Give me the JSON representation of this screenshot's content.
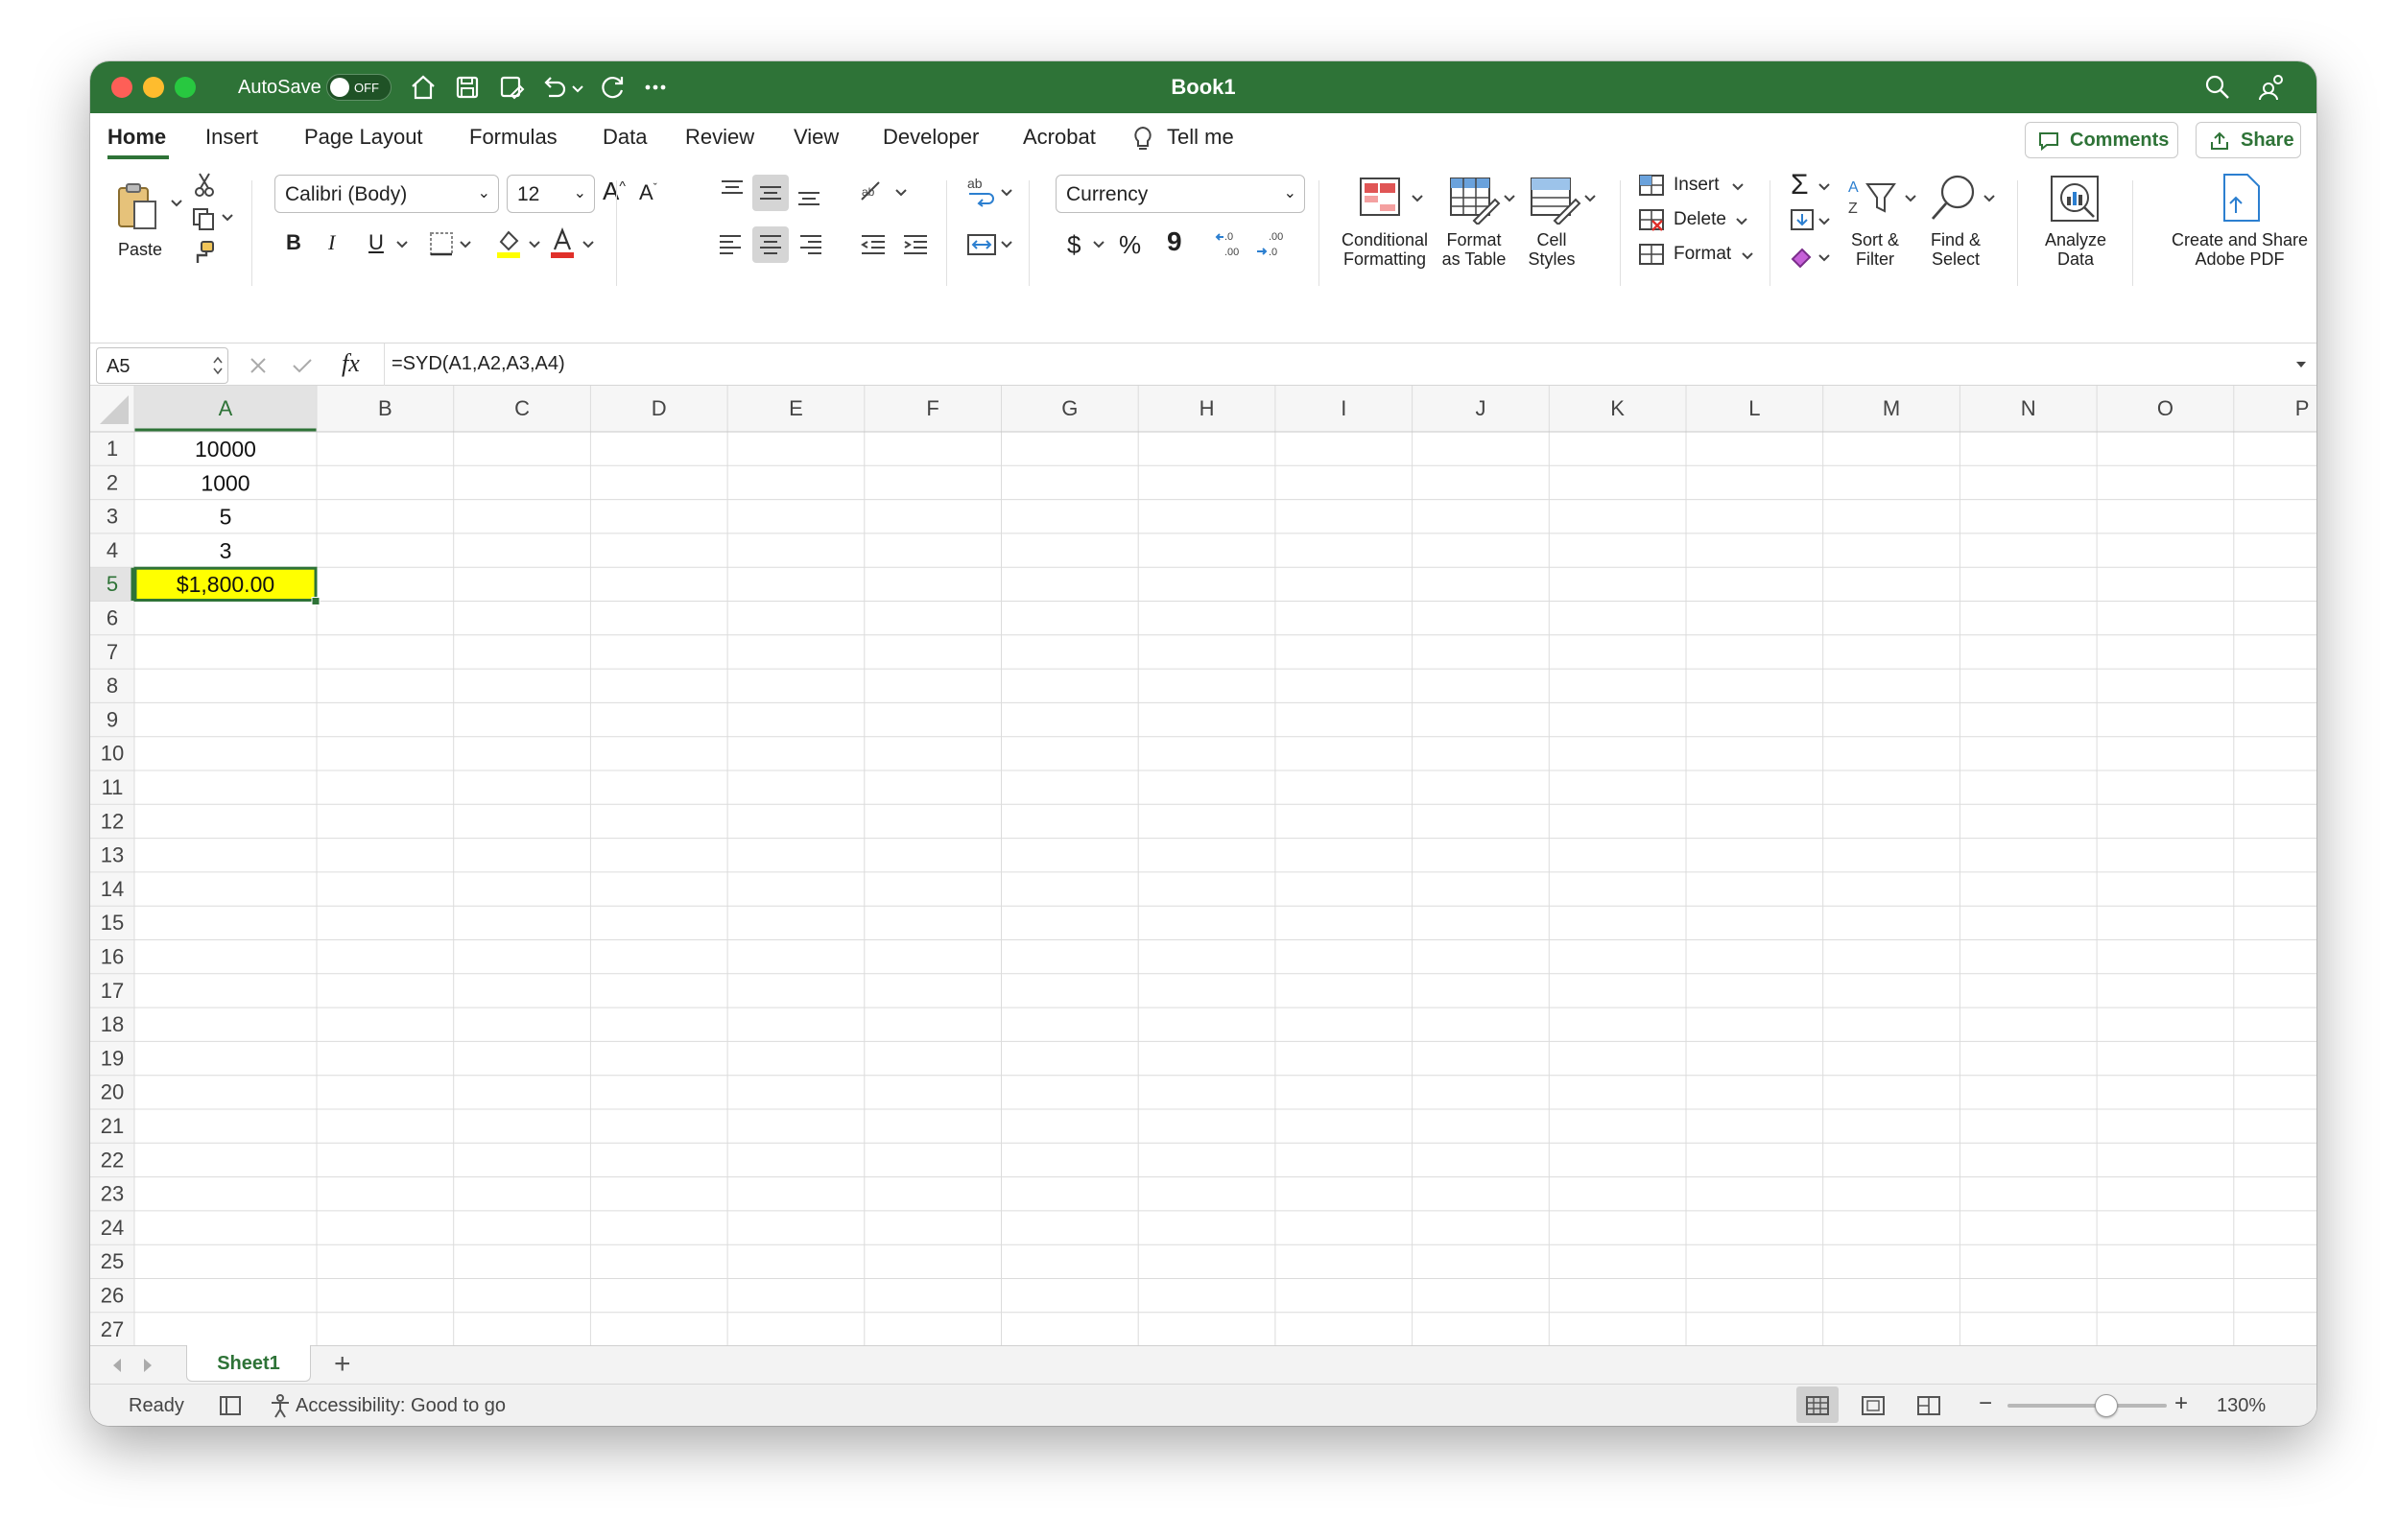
{
  "window": {
    "title": "Book1"
  },
  "titlebar": {
    "autosave_label": "AutoSave",
    "autosave_state": "OFF",
    "icons": [
      "home-icon",
      "save-icon",
      "save-as-icon",
      "undo-icon",
      "redo-icon",
      "more-icon",
      "search-icon",
      "share-people-icon"
    ]
  },
  "tabs": [
    "Home",
    "Insert",
    "Page Layout",
    "Formulas",
    "Data",
    "Review",
    "View",
    "Developer",
    "Acrobat"
  ],
  "tell_me": "Tell me",
  "buttons": {
    "comments": "Comments",
    "share": "Share"
  },
  "ribbon": {
    "paste": "Paste",
    "font_name": "Calibri (Body)",
    "font_size": "12",
    "bold": "B",
    "italic": "I",
    "underline": "U",
    "number_format": "Currency",
    "currency_symbol": "$",
    "percent_symbol": "%",
    "comma_symbol": "9",
    "conditional_formatting": [
      "Conditional",
      "Formatting"
    ],
    "format_as_table": [
      "Format",
      "as Table"
    ],
    "cell_styles": [
      "Cell",
      "Styles"
    ],
    "insert": "Insert",
    "delete": "Delete",
    "format": "Format",
    "sort_filter": [
      "Sort &",
      "Filter"
    ],
    "find_select": [
      "Find &",
      "Select"
    ],
    "analyze_data": [
      "Analyze",
      "Data"
    ],
    "adobe_pdf": [
      "Create and Share",
      "Adobe PDF"
    ]
  },
  "formula_bar": {
    "name_box": "A5",
    "fx": "fx",
    "formula": "=SYD(A1,A2,A3,A4)"
  },
  "sheet": {
    "columns": [
      "A",
      "B",
      "C",
      "D",
      "E",
      "F",
      "G",
      "H",
      "I",
      "J",
      "K",
      "L",
      "M",
      "N",
      "O",
      "P"
    ],
    "row_count": 29,
    "active_cell": "A5",
    "cells": {
      "A1": "10000",
      "A2": "1000",
      "A3": "5",
      "A4": "3",
      "A5": "$1,800.00"
    },
    "highlight_color": "#ffff00",
    "accent_color": "#2e7337"
  },
  "sheet_tabs": {
    "active": "Sheet1",
    "add": "+"
  },
  "status": {
    "ready": "Ready",
    "accessibility": "Accessibility: Good to go",
    "zoom": "130%",
    "zoom_minus": "−",
    "zoom_plus": "+",
    "zoom_level": 0.62
  }
}
